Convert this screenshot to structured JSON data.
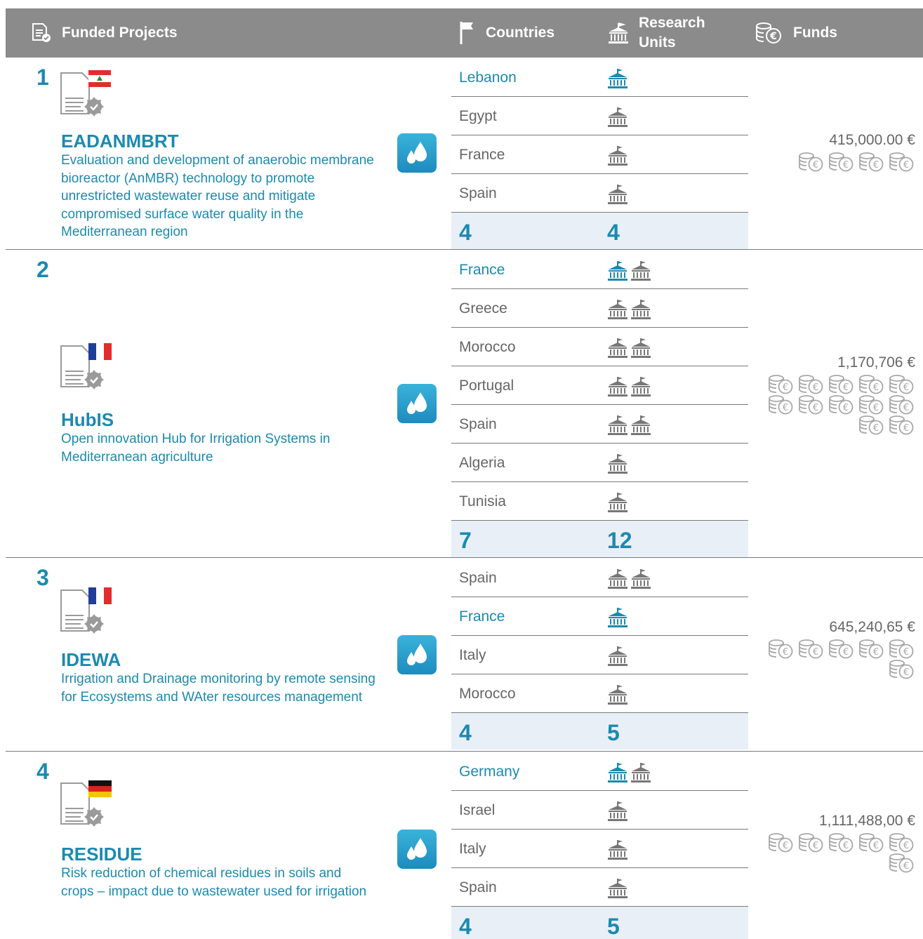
{
  "header": {
    "projects_label": "Funded Projects",
    "countries_label": "Countries",
    "units_label_line1": "Research",
    "units_label_line2": "Units",
    "funds_label": "Funds"
  },
  "colors": {
    "accent": "#1b8ab0",
    "header_bg": "#8b8b8b",
    "total_bg": "#e9eff7",
    "icon_gray": "#777777"
  },
  "projects": [
    {
      "number": "1",
      "flag": "lebanon",
      "acronym": "EADANMBRT",
      "description": "Evaluation and development of anaerobic membrane bioreactor (AnMBR) technology to promote unrestricted wastewater reuse and mitigate compromised surface water quality in the Mediterranean region",
      "rows": [
        {
          "country": "Lebanon",
          "units": 1,
          "lead": true
        },
        {
          "country": "Egypt",
          "units": 1,
          "lead": false
        },
        {
          "country": "France",
          "units": 1,
          "lead": false
        },
        {
          "country": "Spain",
          "units": 1,
          "lead": false
        }
      ],
      "total_countries": "4",
      "total_units": "4",
      "funds": "415,000.00 €",
      "coin_count": 4
    },
    {
      "number": "2",
      "flag": "france",
      "acronym": "HubIS",
      "description": "Open innovation Hub for Irrigation Systems in Mediterranean agriculture",
      "rows": [
        {
          "country": "France",
          "units": 2,
          "lead": true
        },
        {
          "country": "Greece",
          "units": 2,
          "lead": false
        },
        {
          "country": "Morocco",
          "units": 2,
          "lead": false
        },
        {
          "country": "Portugal",
          "units": 2,
          "lead": false
        },
        {
          "country": "Spain",
          "units": 2,
          "lead": false
        },
        {
          "country": "Algeria",
          "units": 1,
          "lead": false
        },
        {
          "country": "Tunisia",
          "units": 1,
          "lead": false
        }
      ],
      "total_countries": "7",
      "total_units": "12",
      "funds": "1,170,706 €",
      "coin_count": 12
    },
    {
      "number": "3",
      "flag": "france",
      "acronym": "IDEWA",
      "description": "Irrigation and Drainage monitoring by remote sensing for Ecosystems and WAter resources management",
      "rows": [
        {
          "country": "Spain",
          "units": 2,
          "lead": false
        },
        {
          "country": "France",
          "units": 1,
          "lead": true
        },
        {
          "country": "Italy",
          "units": 1,
          "lead": false
        },
        {
          "country": "Morocco",
          "units": 1,
          "lead": false
        }
      ],
      "total_countries": "4",
      "total_units": "5",
      "funds": "645,240,65 €",
      "coin_count": 6
    },
    {
      "number": "4",
      "flag": "germany",
      "acronym": "RESIDUE",
      "description": "Risk reduction of chemical residues in soils and crops – impact due to wastewater used for irrigation",
      "rows": [
        {
          "country": "Germany",
          "units": 2,
          "lead": true
        },
        {
          "country": "Israel",
          "units": 1,
          "lead": false
        },
        {
          "country": "Italy",
          "units": 1,
          "lead": false
        },
        {
          "country": "Spain",
          "units": 1,
          "lead": false
        }
      ],
      "total_countries": "4",
      "total_units": "5",
      "funds": "1,111,488,00 €",
      "coin_count": 6
    }
  ]
}
